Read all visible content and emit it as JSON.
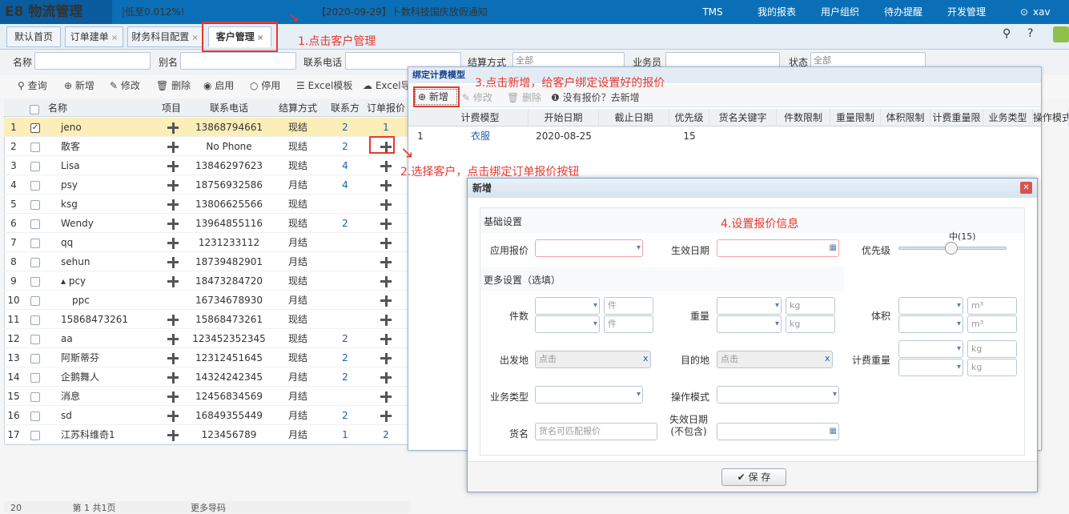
{
  "app": {
    "logo": "E8 物流管理",
    "ticker": "|低至0.012%!",
    "notice": "【2020-09-29】卜数科技国庆放假通知",
    "nav": [
      "TMS",
      "我的报表",
      "用户组织",
      "待办提醒",
      "开发管理"
    ],
    "user": "xav"
  },
  "tabs": [
    {
      "label": "默认首页"
    },
    {
      "label": "订单建单",
      "close": "×"
    },
    {
      "label": "财务科目配置",
      "close": "×"
    },
    {
      "label": "客户管理",
      "close": "×"
    }
  ],
  "filters": {
    "name": "名称",
    "alias": "别名",
    "phone": "联系电话",
    "settle": "结算方式",
    "settle_value": "全部",
    "salesman": "业务员",
    "status": "状态",
    "status_value": "全部"
  },
  "toolbar": [
    "查询",
    "新增",
    "修改",
    "删除",
    "启用",
    "停用",
    "Excel模板",
    "Excel导"
  ],
  "grid": {
    "headers": [
      "名称",
      "项目",
      "联系电话",
      "结算方式",
      "联系方",
      "订单报价"
    ],
    "rows": [
      {
        "n": "1",
        "name": "jeno",
        "phone": "13868794661",
        "settle": "现结",
        "c": "2",
        "q": "1",
        "sel": true
      },
      {
        "n": "2",
        "name": "散客",
        "phone": "No Phone",
        "settle": "现结",
        "c": "2",
        "q": ""
      },
      {
        "n": "3",
        "name": "Lisa",
        "phone": "13846297623",
        "settle": "现结",
        "c": "4",
        "q": ""
      },
      {
        "n": "4",
        "name": "psy",
        "phone": "18756932586",
        "settle": "月结",
        "c": "4",
        "q": ""
      },
      {
        "n": "5",
        "name": "ksg",
        "phone": "13806625566",
        "settle": "现结",
        "c": "",
        "q": ""
      },
      {
        "n": "6",
        "name": "Wendy",
        "phone": "13964855116",
        "settle": "现结",
        "c": "2",
        "q": ""
      },
      {
        "n": "7",
        "name": "qq",
        "phone": "1231233112",
        "settle": "月结",
        "c": "",
        "q": ""
      },
      {
        "n": "8",
        "name": "sehun",
        "phone": "18739482901",
        "settle": "月结",
        "c": "",
        "q": ""
      },
      {
        "n": "9",
        "name": "▴ pcy",
        "phone": "18473284720",
        "settle": "现结",
        "c": "",
        "q": ""
      },
      {
        "n": "10",
        "name": "ppc",
        "phone": "16734678930",
        "settle": "月结",
        "c": "",
        "q": "",
        "noplus": true
      },
      {
        "n": "11",
        "name": "15868473261",
        "phone": "15868473261",
        "settle": "现结",
        "c": "",
        "q": ""
      },
      {
        "n": "12",
        "name": "aa",
        "phone": "123452352345",
        "settle": "现结",
        "c": "2",
        "q": ""
      },
      {
        "n": "13",
        "name": "阿斯蒂芬",
        "phone": "12312451645",
        "settle": "现结",
        "c": "2",
        "q": ""
      },
      {
        "n": "14",
        "name": "企鹅舞人",
        "phone": "14324242345",
        "settle": "月结",
        "c": "2",
        "q": ""
      },
      {
        "n": "15",
        "name": "消息",
        "phone": "12456834569",
        "settle": "月结",
        "c": "",
        "q": ""
      },
      {
        "n": "16",
        "name": "sd",
        "phone": "16849355449",
        "settle": "月结",
        "c": "2",
        "q": ""
      },
      {
        "n": "17",
        "name": "江苏科维奇1",
        "phone": "123456789",
        "settle": "月结",
        "c": "1",
        "q": "2"
      }
    ]
  },
  "pager": {
    "size": "20",
    "page_label": "第",
    "page": "1",
    "total": "共1页",
    "refresh": "更多导码"
  },
  "panel": {
    "title": "绑定计费模型",
    "tools": [
      "新增",
      "修改",
      "删除",
      "没有报价？去新增"
    ],
    "headers": [
      "计费模型",
      "开始日期",
      "截止日期",
      "优先级",
      "货名关键字",
      "件数限制",
      "重量限制",
      "体积限制",
      "计费重量限",
      "业务类型",
      "操作模式"
    ],
    "row": {
      "n": "1",
      "model": "衣服",
      "start": "2020-08-25",
      "priority": "15"
    }
  },
  "dialog": {
    "title": "新增",
    "basic": "基础设置",
    "more": "更多设置（选填）",
    "apply": "应用报价",
    "effective": "生效日期",
    "priority": "优先级",
    "priority_value": "中(15)",
    "pieces": "件数",
    "weight": "重量",
    "volume": "体积",
    "origin": "出发地",
    "dest": "目的地",
    "charge_weight": "计费重量",
    "biz_type": "业务类型",
    "op_mode": "操作模式",
    "goods": "货名",
    "goods_ph": "货名可匹配报价",
    "expire": "失效日期(不包含)",
    "click": "点击",
    "unit_piece": "件",
    "unit_kg": "kg",
    "unit_m3": "m³",
    "save": "保 存"
  },
  "annotations": [
    "1.点击客户管理",
    "2.选择客户，点击绑定订单报价按钮",
    "3.点击新增，给客户绑定设置好的报价",
    "4.设置报价信息"
  ]
}
